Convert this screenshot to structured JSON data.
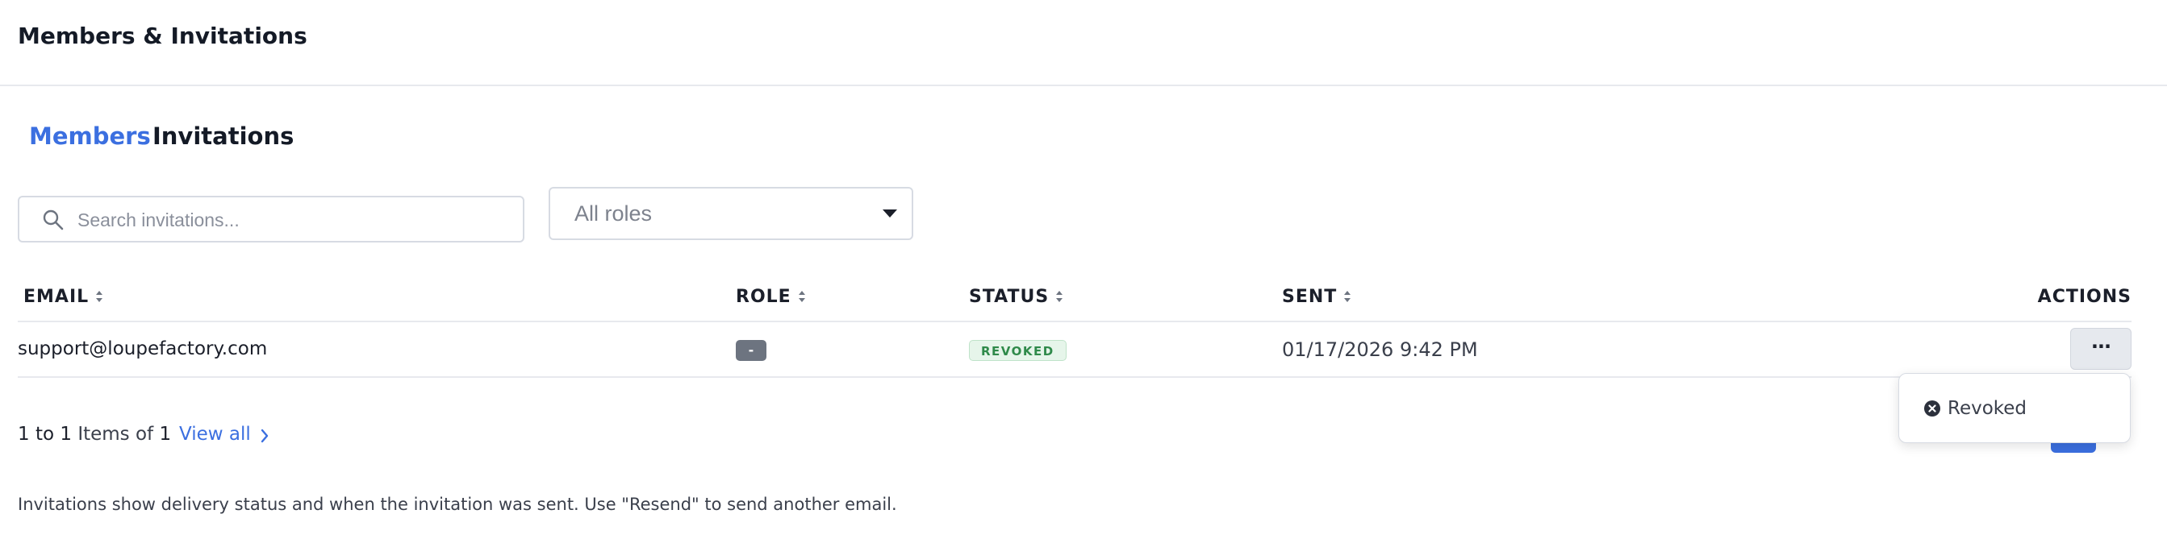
{
  "page": {
    "title": "Members & Invitations"
  },
  "tabs": [
    {
      "label": "Members",
      "active": true
    },
    {
      "label": "Invitations",
      "active": false
    }
  ],
  "search": {
    "placeholder": "Search invitations...",
    "value": "",
    "icon": "search-icon"
  },
  "role_filter": {
    "value": "All roles",
    "icon": "caret-down-icon"
  },
  "table": {
    "columns": [
      "EMAIL",
      "ROLE",
      "STATUS",
      "SENT",
      "ACTIONS"
    ],
    "rows": [
      {
        "email": "support@loupefactory.com",
        "role": "-",
        "status": "REVOKED",
        "sent": "01/17/2026 9:42 PM",
        "actions_label": "···"
      }
    ]
  },
  "actions_menu": {
    "items": [
      {
        "label": "Revoked",
        "icon": "x-circle-icon"
      }
    ]
  },
  "pagination": {
    "from": "1",
    "to_word": "to",
    "to": "1",
    "items_of": "Items of",
    "total": "1",
    "view_all": "View all"
  },
  "footer": {
    "note": "Invitations show delivery status and when the invitation was sent. Use \"Resend\" to send another email."
  },
  "colors": {
    "accent": "#3b6fe0",
    "status_revoked_bg": "#e6f5ea",
    "status_revoked_text": "#2f8a4a",
    "role_badge_bg": "#6d7480"
  }
}
